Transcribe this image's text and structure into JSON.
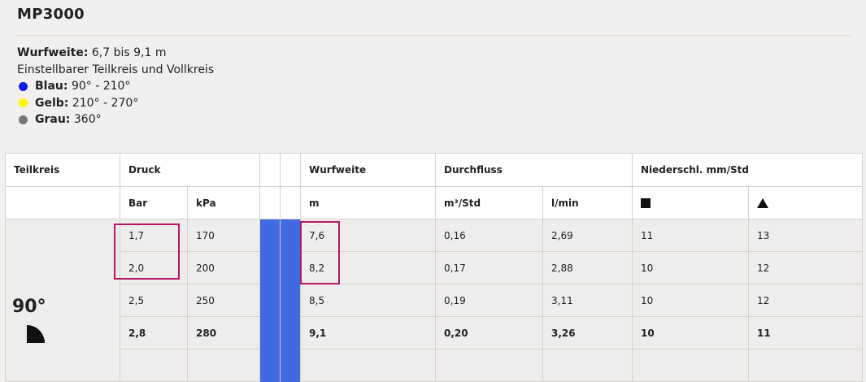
{
  "product": {
    "title": "MP3000"
  },
  "info": {
    "range_label": "Wurfweite:",
    "range_value": "6,7 bis 9,1 m",
    "arc_text": "Einstellbarer Teilkreis und Vollkreis",
    "legend": [
      {
        "label": "Blau:",
        "value": "90° - 210°",
        "color": "#0a1ee6"
      },
      {
        "label": "Gelb:",
        "value": "210° - 270°",
        "color": "#fbf500"
      },
      {
        "label": "Grau:",
        "value": "360°",
        "color": "#777777"
      }
    ]
  },
  "table": {
    "headers": {
      "teilkreis": "Teilkreis",
      "druck": "Druck",
      "wurfweite": "Wurfweite",
      "durchfluss": "Durchfluss",
      "niederschl": "Niederschl. mm/Std"
    },
    "subheaders": {
      "bar": "Bar",
      "kpa": "kPa",
      "m": "m",
      "m3_std": "m³/Std",
      "l_min": "l/min",
      "square_icon": "square-icon",
      "triangle_icon": "triangle-icon"
    },
    "band_color": "#4169e1",
    "section": {
      "degree": "90°",
      "icon": "quarter-circle-icon"
    },
    "rows": [
      {
        "bar": "1,7",
        "kpa": "170",
        "m": "7,6",
        "m3": "0,16",
        "lmin": "2,69",
        "sq": "11",
        "tri": "13"
      },
      {
        "bar": "2,0",
        "kpa": "200",
        "m": "8,2",
        "m3": "0,17",
        "lmin": "2,88",
        "sq": "10",
        "tri": "12"
      },
      {
        "bar": "2,5",
        "kpa": "250",
        "m": "8,5",
        "m3": "0,19",
        "lmin": "3,11",
        "sq": "10",
        "tri": "12"
      },
      {
        "bar": "2,8",
        "kpa": "280",
        "m": "9,1",
        "m3": "0,20",
        "lmin": "3,26",
        "sq": "10",
        "tri": "11"
      }
    ]
  },
  "highlight_color": "#b5166b"
}
